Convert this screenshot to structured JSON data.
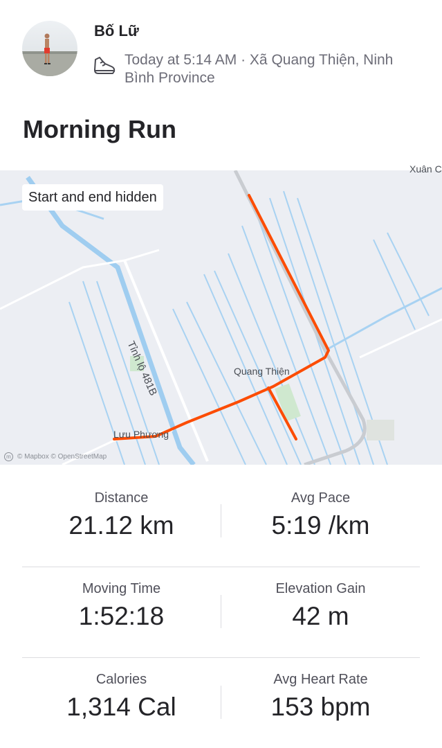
{
  "athlete": {
    "name": "Bố Lữ"
  },
  "activity": {
    "meta": "Today at 5:14 AM · Xã Quang Thiện, Ninh Bình Province",
    "title": "Morning Run",
    "sport_icon": "running-shoe-icon"
  },
  "map": {
    "privacy_label": "Start and end hidden",
    "place_labels": [
      "Quang Thiện",
      "Lưu Phương",
      "Xuân C"
    ],
    "road_label": "Tỉnh lộ 481B",
    "attribution": "© Mapbox © OpenStreetMap",
    "route_color": "#fc4c02"
  },
  "stats": [
    {
      "label": "Distance",
      "value": "21.12 km"
    },
    {
      "label": "Avg Pace",
      "value": "5:19 /km"
    },
    {
      "label": "Moving Time",
      "value": "1:52:18"
    },
    {
      "label": "Elevation Gain",
      "value": "42 m"
    },
    {
      "label": "Calories",
      "value": "1,314 Cal"
    },
    {
      "label": "Avg Heart Rate",
      "value": "153 bpm"
    }
  ]
}
